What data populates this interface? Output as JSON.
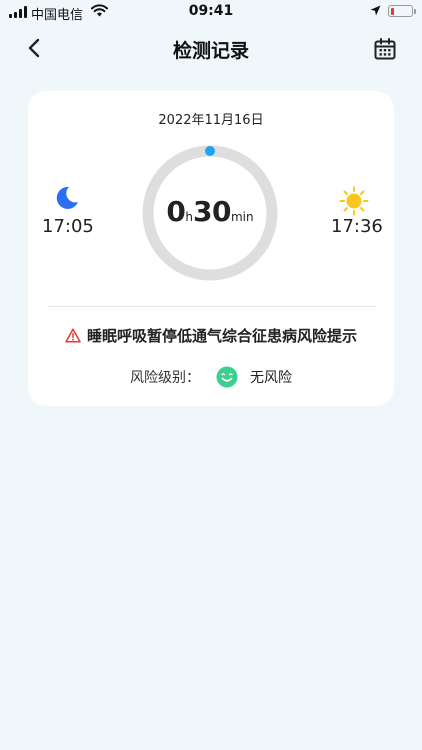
{
  "status_bar": {
    "carrier": "中国电信",
    "time": "09:41"
  },
  "nav": {
    "title": "检测记录",
    "back_icon": "chevron-left-icon",
    "calendar_icon": "calendar-icon"
  },
  "record": {
    "date": "2022年11月16日",
    "duration": {
      "hours": "0",
      "hours_unit": "h",
      "minutes": "30",
      "minutes_unit": "min"
    },
    "sleep_time": "17:05",
    "wake_time": "17:36",
    "warning": "睡眠呼吸暂停低通气综合征患病风险提示",
    "risk_label": "风险级别：",
    "risk_value": "无风险"
  },
  "colors": {
    "background": "#eff7fb",
    "accent_blue": "#1fa3f0",
    "moon_blue": "#2b6ff3",
    "sun_yellow": "#f9c51e",
    "smile_green": "#3ccf8e",
    "warning_red": "#e53935",
    "ring_gray": "#dedede"
  }
}
